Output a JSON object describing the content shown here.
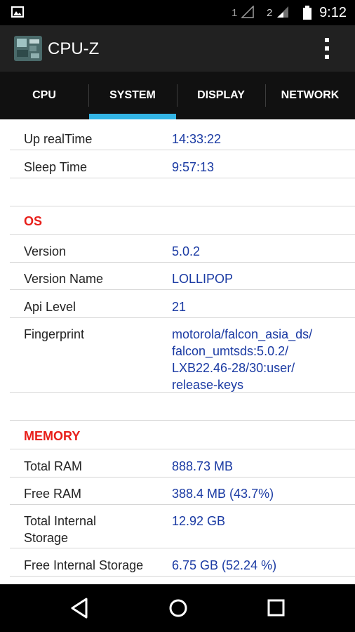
{
  "status_bar": {
    "time": "9:12",
    "sim1": "1",
    "sim2": "2"
  },
  "app": {
    "title": "CPU-Z"
  },
  "tabs": [
    {
      "label": "CPU"
    },
    {
      "label": "SYSTEM"
    },
    {
      "label": "DISPLAY"
    },
    {
      "label": "NETWORK"
    }
  ],
  "active_tab": "SYSTEM",
  "rows": {
    "uptime": {
      "label": "Up realTime",
      "value": "14:33:22"
    },
    "sleep": {
      "label": "Sleep Time",
      "value": "9:57:13"
    }
  },
  "os": {
    "header": "OS",
    "version": {
      "label": "Version",
      "value": "5.0.2"
    },
    "version_name": {
      "label": "Version Name",
      "value": "LOLLIPOP"
    },
    "api_level": {
      "label": "Api Level",
      "value": "21"
    },
    "fingerprint": {
      "label": "Fingerprint",
      "value": "motorola/falcon_asia_ds/ falcon_umtsds:5.0.2/ LXB22.46-28/30:user/ release-keys"
    }
  },
  "memory": {
    "header": "MEMORY",
    "total_ram": {
      "label": "Total RAM",
      "value": "888.73 MB"
    },
    "free_ram": {
      "label": "Free RAM",
      "value": "388.4 MB (43.7%)"
    },
    "total_storage": {
      "label": "Total Internal Storage",
      "value": "12.92 GB"
    },
    "free_storage": {
      "label": "Free Internal Storage",
      "value": "6.75 GB (52.24 %)"
    }
  },
  "colors": {
    "accent": "#33b5e5",
    "section_header": "#e8201b",
    "value_text": "#1a3aa3"
  }
}
